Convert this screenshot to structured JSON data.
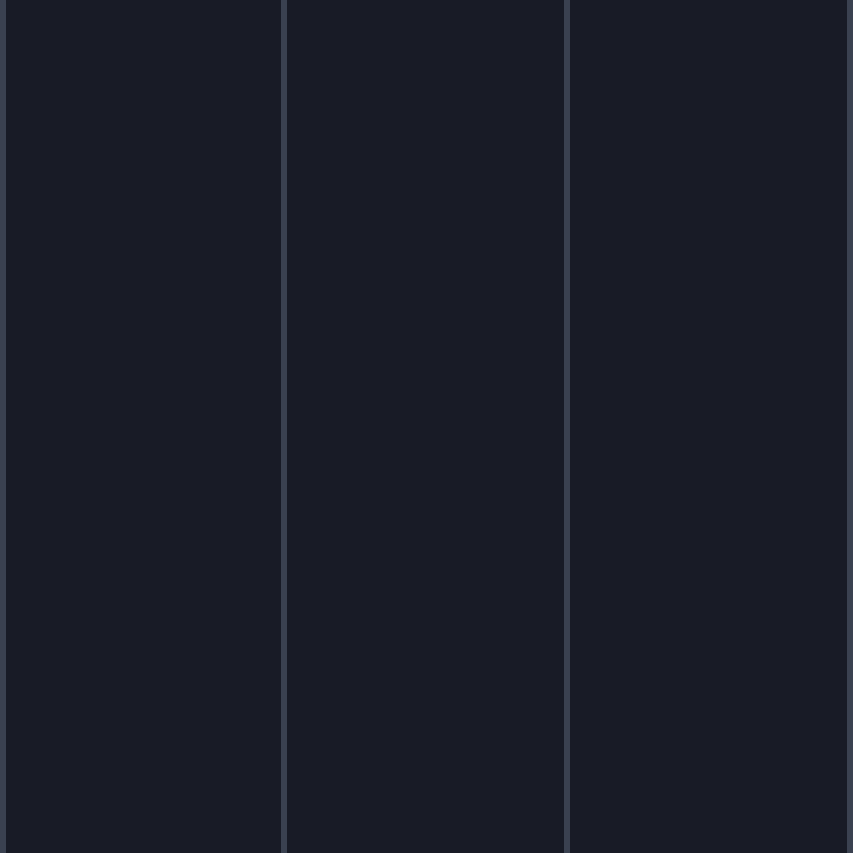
{
  "theme": {
    "pane_background": "#181b26",
    "divider_color": "#3a4150"
  },
  "panes": [
    {
      "id": "pane-1"
    },
    {
      "id": "pane-2"
    },
    {
      "id": "pane-3"
    }
  ]
}
